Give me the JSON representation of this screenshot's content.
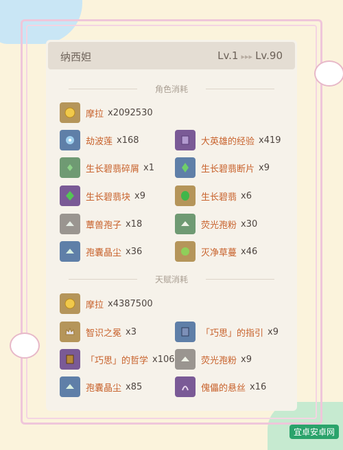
{
  "header": {
    "name": "纳西妲",
    "lv_from": "Lv.1",
    "lv_to": "Lv.90",
    "arrows": "▸▸▸"
  },
  "sections": {
    "ascension_title": "角色消耗",
    "talent_title": "天赋消耗"
  },
  "ascension": [
    {
      "name": "摩拉",
      "qty": "x2092530"
    },
    {
      "name": "劫波莲",
      "qty": "x168"
    },
    {
      "name": "大英雄的经验",
      "qty": "x419"
    },
    {
      "name": "生长碧翡碎屑",
      "qty": "x1"
    },
    {
      "name": "生长碧翡断片",
      "qty": "x9"
    },
    {
      "name": "生长碧翡块",
      "qty": "x9"
    },
    {
      "name": "生长碧翡",
      "qty": "x6"
    },
    {
      "name": "蕈兽孢子",
      "qty": "x18"
    },
    {
      "name": "荧光孢粉",
      "qty": "x30"
    },
    {
      "name": "孢囊晶尘",
      "qty": "x36"
    },
    {
      "name": "灭净草蔓",
      "qty": "x46"
    }
  ],
  "talent": [
    {
      "name": "摩拉",
      "qty": "x4387500"
    },
    {
      "name": "智识之冕",
      "qty": "x3"
    },
    {
      "name": "「巧思」的指引",
      "qty": "x9"
    },
    {
      "name": "「巧思」的哲学",
      "qty": "x106"
    },
    {
      "name": "荧光孢粉",
      "qty": "x9"
    },
    {
      "name": "孢囊晶尘",
      "qty": "x85"
    },
    {
      "name": "傀儡的悬丝",
      "qty": "x16"
    }
  ],
  "watermark": "宜卓安卓网",
  "colors": {
    "item_name": "#c8622c",
    "panel": "#f6f2ea",
    "header": "#e4ddd3"
  }
}
